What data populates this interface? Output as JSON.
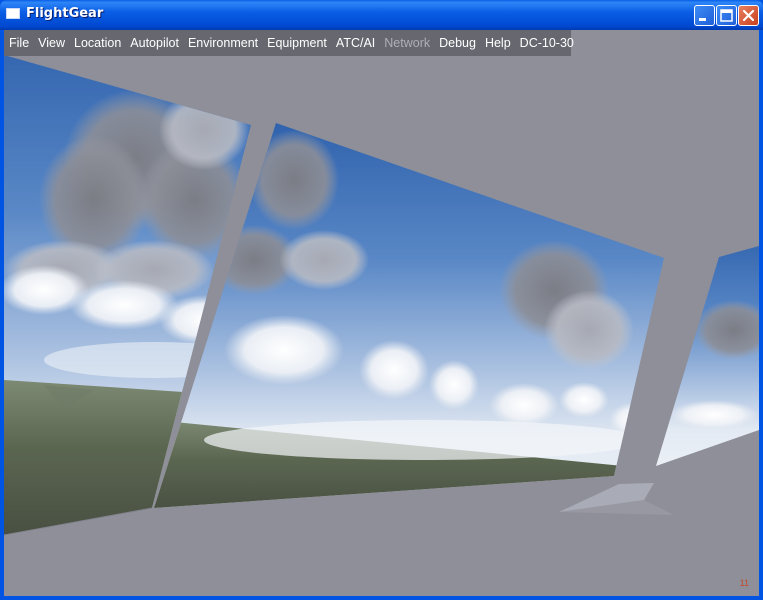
{
  "window": {
    "title": "FlightGear"
  },
  "menu": [
    {
      "label": "File",
      "enabled": true
    },
    {
      "label": "View",
      "enabled": true
    },
    {
      "label": "Location",
      "enabled": true
    },
    {
      "label": "Autopilot",
      "enabled": true
    },
    {
      "label": "Environment",
      "enabled": true
    },
    {
      "label": "Equipment",
      "enabled": true
    },
    {
      "label": "ATC/AI",
      "enabled": true
    },
    {
      "label": "Network",
      "enabled": false
    },
    {
      "label": "Debug",
      "enabled": true
    },
    {
      "label": "Help",
      "enabled": true
    },
    {
      "label": "DC-10-30",
      "enabled": true
    }
  ],
  "status": {
    "fps": "11"
  },
  "colors": {
    "titlebar": "#0054e3",
    "cockpit_frame": "#8e8f98",
    "sky_top": "#3d6fb8",
    "horizon": "#e6ecf4",
    "close_button": "#c8401e"
  },
  "icons": {
    "app": "window-icon",
    "minimize": "minimize-icon",
    "maximize": "maximize-icon",
    "close": "close-icon"
  }
}
